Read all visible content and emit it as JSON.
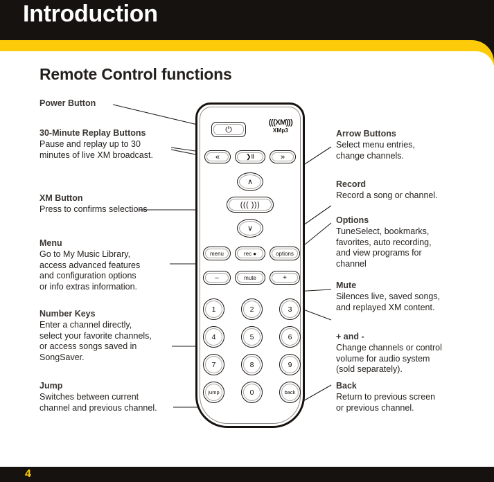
{
  "header": {
    "title": "Introduction",
    "accent_color": "#fdcb09",
    "bar_color": "#151210"
  },
  "page": {
    "section_heading": "Remote Control functions",
    "page_number": "4"
  },
  "callouts_left": [
    {
      "title": "Power Button",
      "body": ""
    },
    {
      "title": "30-Minute Replay Buttons",
      "body": "Pause and replay up to 30\nminutes of live XM broadcast."
    },
    {
      "title": "XM Button",
      "body": "Press to confirms selections"
    },
    {
      "title": "Menu",
      "body": "Go to My Music Library,\naccess advanced features\nand configuration options\nor info extras information."
    },
    {
      "title": "Number Keys",
      "body": "Enter a channel directly,\nselect your favorite channels,\nor access songs saved in\nSongSaver."
    },
    {
      "title": "Jump",
      "body": "Switches between current\nchannel and previous channel."
    }
  ],
  "callouts_right": [
    {
      "title": "Arrow Buttons",
      "body": "Select menu entries,\nchange channels."
    },
    {
      "title": "Record",
      "body": "Record a song or channel."
    },
    {
      "title": "Options",
      "body": "TuneSelect, bookmarks,\nfavorites, auto recording,\nand view programs for\nchannel"
    },
    {
      "title": "Mute",
      "body": "Silences live, saved songs,\nand replayed XM content."
    },
    {
      "title": "+ and -",
      "body": "Change channels or control\nvolume for audio system\n(sold separately)."
    },
    {
      "title": "Back",
      "body": "Return to previous screen\nor previous channel."
    }
  ],
  "remote": {
    "brand_mark": "(((XM)))",
    "brand_sub": "XMp3",
    "power_glyph": "⏻",
    "transport": {
      "prev": "«",
      "play": "❯Ⅱ",
      "next": "»"
    },
    "nav": {
      "up": "∧",
      "down": "∨",
      "xm": "((( )))"
    },
    "functions": {
      "menu": "menu",
      "rec": "rec ●",
      "options": "options"
    },
    "volume": {
      "minus": "–",
      "mute": "mute",
      "plus": "+"
    },
    "keypad": [
      "1",
      "2",
      "3",
      "4",
      "5",
      "6",
      "7",
      "8",
      "9",
      "jump",
      "0",
      "back"
    ]
  }
}
